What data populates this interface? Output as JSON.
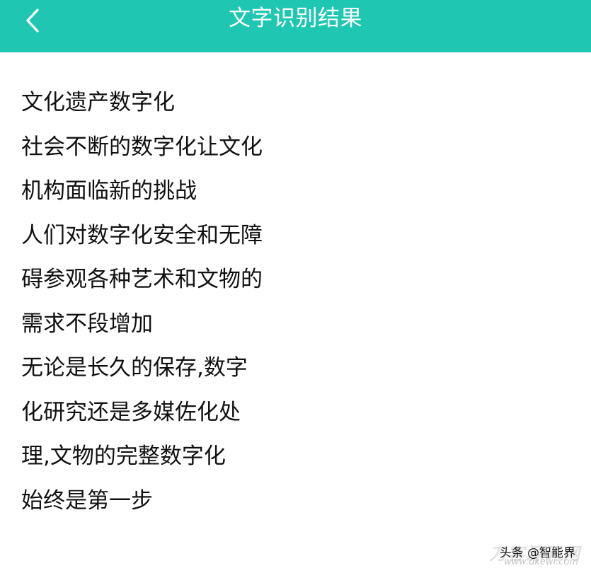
{
  "colors": {
    "header_bg": "#1fc7b3",
    "header_text": "#ffffff",
    "body_text": "#111111"
  },
  "header": {
    "back_icon": "chevron-left-icon",
    "title": "文字识别结果"
  },
  "result_lines": [
    "文化遗产数字化",
    "社会不断的数字化让文化",
    "机构面临新的挑战",
    "人们对数字化安全和无障",
    "碍参观各种艺术和文物的",
    "需求不段增加",
    "无论是长久的保存,数字",
    "化研究还是多媒佐化处",
    "理,文物的完整数字化",
    "始终是第一步"
  ],
  "watermark": {
    "label": "头条 @智能界",
    "site_text": "刀客源码网",
    "url": "www.dkewl.com"
  }
}
